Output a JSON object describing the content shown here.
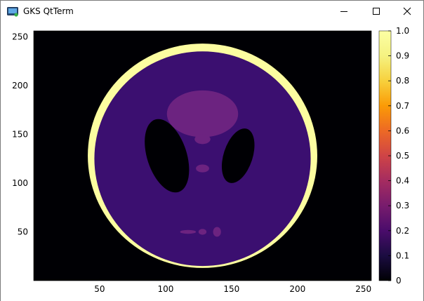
{
  "window": {
    "title": "GKS QtTerm",
    "controls": [
      "minimize",
      "maximize",
      "close"
    ]
  },
  "chart_data": {
    "type": "heatmap",
    "title": "",
    "xlabel": "",
    "ylabel": "",
    "xlim": [
      0,
      256
    ],
    "ylim": [
      0,
      256
    ],
    "x_ticks": [
      50,
      100,
      150,
      200,
      250
    ],
    "y_ticks": [
      50,
      100,
      150,
      200,
      250
    ],
    "colormap": "inferno",
    "colorbar": {
      "range": [
        0,
        1
      ],
      "ticks": [
        "0",
        "0.1",
        "0.2",
        "0.3",
        "0.4",
        "0.5",
        "0.6",
        "0.7",
        "0.8",
        "0.9",
        "1.0"
      ]
    },
    "image": "Shepp-Logan phantom",
    "ellipses": [
      {
        "name": "skull",
        "value": 1.0,
        "cx": 128,
        "cy": 128,
        "rx": 87,
        "ry": 115
      },
      {
        "name": "brain",
        "value": 0.2,
        "cx": 128,
        "cy": 125,
        "rx": 82,
        "ry": 110
      },
      {
        "name": "left-ventricle",
        "value": 0.0,
        "cx": 101,
        "cy": 128,
        "rx": 15,
        "ry": 39,
        "angle": 18
      },
      {
        "name": "right-ventricle",
        "value": 0.0,
        "cx": 155,
        "cy": 128,
        "rx": 11,
        "ry": 29,
        "angle": -18
      },
      {
        "name": "top-ellipse",
        "value": 0.3,
        "cx": 128,
        "cy": 171,
        "rx": 27,
        "ry": 24
      },
      {
        "name": "center-dot-upper",
        "value": 0.3,
        "cx": 128,
        "cy": 145,
        "rx": 6,
        "ry": 5
      },
      {
        "name": "center-dot-lower",
        "value": 0.3,
        "cx": 128,
        "cy": 115,
        "rx": 5,
        "ry": 4
      },
      {
        "name": "bottom-dot-left",
        "value": 0.3,
        "cx": 117,
        "cy": 50,
        "rx": 6,
        "ry": 2
      },
      {
        "name": "bottom-dot-center",
        "value": 0.3,
        "cx": 128,
        "cy": 50,
        "rx": 3,
        "ry": 3
      },
      {
        "name": "bottom-dot-right",
        "value": 0.3,
        "cx": 139,
        "cy": 50,
        "rx": 3,
        "ry": 5
      }
    ],
    "colors": {
      "background": "#000004",
      "skull": "#fcfda0",
      "brain": "#3b0f70",
      "feature": "#6c2380"
    }
  }
}
